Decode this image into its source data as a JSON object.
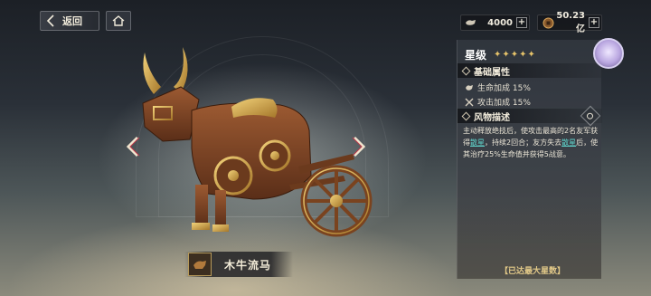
{
  "topbar": {
    "back_label": "返回",
    "resources": [
      {
        "icon": "ox-token-icon",
        "value": "4000"
      },
      {
        "icon": "coin-icon",
        "value": "50.23亿"
      }
    ],
    "plus": "+"
  },
  "item": {
    "name": "木牛流马"
  },
  "panel": {
    "star_label": "星级",
    "stars": "✦✦✦✦✦",
    "basic_title": "基础属性",
    "attributes": [
      {
        "icon": "hp-icon",
        "text": "生命加成 15%"
      },
      {
        "icon": "attack-icon",
        "text": "攻击加成 15%"
      }
    ],
    "desc_title": "风物描述",
    "desc_parts": [
      "主动释放绝技后，使攻击最高的2名友军获得",
      "散星",
      "，持续2回合；友方失去",
      "散星",
      "后，使其治疗25%生命值并获得5战意。"
    ],
    "max_label": "【已达最大星数】"
  },
  "colors": {
    "accent_gold": "#e2c988",
    "highlight": "#5fd0c8"
  }
}
